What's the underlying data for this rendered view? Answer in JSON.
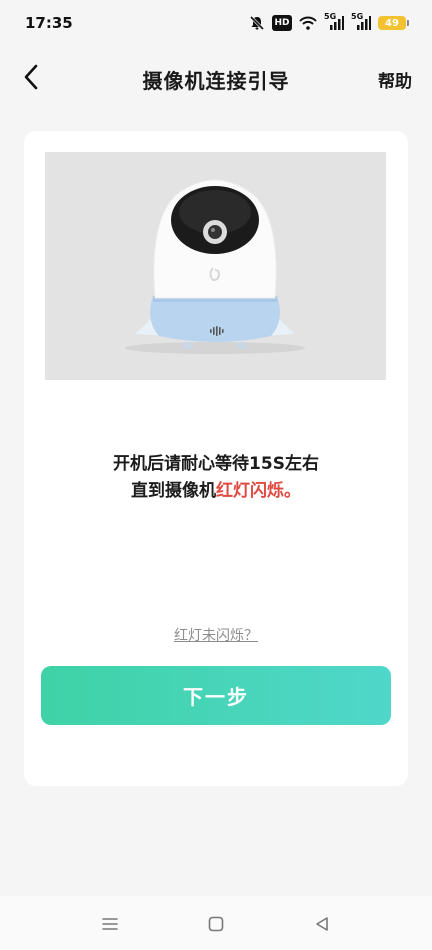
{
  "status_bar": {
    "time": "17:35",
    "hd_label": "HD",
    "signal_1_label": "5G",
    "signal_2_label": "5G",
    "battery_level": "49",
    "icons": [
      "mute-icon",
      "hd-icon",
      "wifi-icon",
      "signal-icon",
      "signal-icon",
      "battery-icon"
    ]
  },
  "nav": {
    "back_icon": "chevron-left-icon",
    "title": "摄像机连接引导",
    "help_label": "帮助"
  },
  "card": {
    "image_alt": "camera-device",
    "instruction_line1": "开机后请耐心等待15S左右",
    "instruction_line2_prefix": "直到摄像机",
    "instruction_line2_highlight": "红灯闪烁。",
    "help_link": "红灯未闪烁？",
    "next_button": "下一步"
  },
  "colors": {
    "background": "#f5f5f5",
    "card": "#ffffff",
    "highlight": "#e04a42",
    "button_gradient_start": "#3fd2a6",
    "button_gradient_end": "#4fd7ca",
    "battery": "#f2c230"
  },
  "system_nav": {
    "icons": [
      "menu-icon",
      "home-icon",
      "back-triangle-icon"
    ]
  }
}
